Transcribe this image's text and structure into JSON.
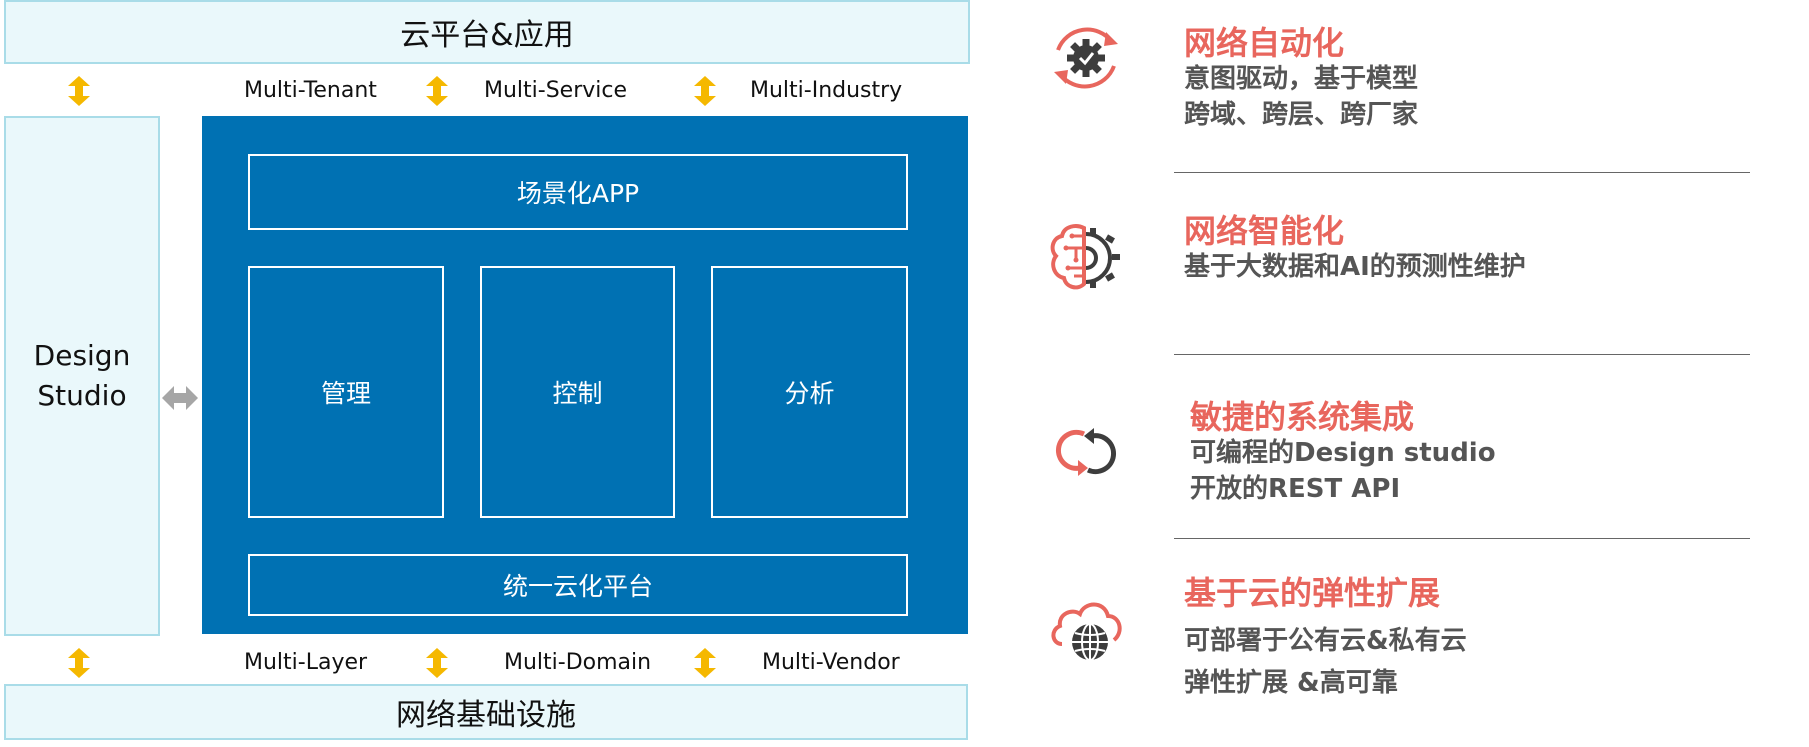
{
  "architecture": {
    "top_bar": "云平台&应用",
    "bottom_bar": "网络基础设施",
    "design_studio": [
      "Design",
      "Studio"
    ],
    "top_labels": [
      "Multi-Tenant",
      "Multi-Service",
      "Multi-Industry"
    ],
    "bottom_labels": [
      "Multi-Layer",
      "Multi-Domain",
      "Multi-Vendor"
    ],
    "scenario_app": "场景化APP",
    "modules": [
      "管理",
      "控制",
      "分析"
    ],
    "unified_platform": "统一云化平台"
  },
  "features": [
    {
      "title": "网络自动化",
      "lines": [
        "意图驱动，基于模型",
        "跨域、跨层、跨厂家"
      ],
      "icon": "automation-gear-cycle-icon"
    },
    {
      "title": "网络智能化",
      "lines": [
        "基于大数据和AI的预测性维护"
      ],
      "icon": "brain-gear-icon"
    },
    {
      "title": "敏捷的系统集成",
      "lines": [
        "可编程的Design studio",
        "开放的REST API"
      ],
      "icon": "linked-cycle-icon"
    },
    {
      "title": "基于云的弹性扩展",
      "lines": [
        "可部署于公有云&私有云",
        "弹性扩展 &高可靠"
      ],
      "icon": "cloud-globe-icon"
    }
  ],
  "colors": {
    "accent_red": "#e8665d",
    "primary_blue": "#0071b3",
    "light_box_fill": "#eaf8fb",
    "light_box_border": "#a9dce8",
    "arrow_yellow": "#f5b800",
    "icon_dark": "#3d3d3d",
    "text_gray": "#555555"
  }
}
